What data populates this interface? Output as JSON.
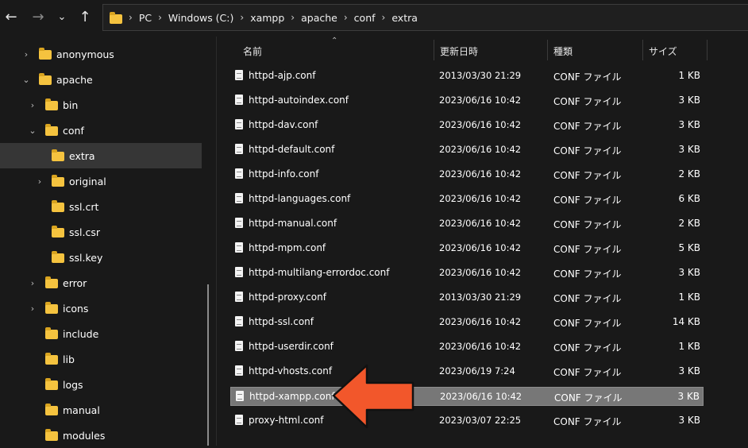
{
  "nav": {
    "back_icon": "arrow-left-icon",
    "forward_icon": "arrow-right-icon",
    "recent_icon": "chevron-down-icon",
    "up_icon": "arrow-up-icon"
  },
  "breadcrumb": [
    "PC",
    "Windows (C:)",
    "xampp",
    "apache",
    "conf",
    "extra"
  ],
  "tree": [
    {
      "label": "anonymous",
      "chevron": "›",
      "level": 1
    },
    {
      "label": "apache",
      "chevron": "⌄",
      "level": 1
    },
    {
      "label": "bin",
      "chevron": "›",
      "level": 2
    },
    {
      "label": "conf",
      "chevron": "⌄",
      "level": 2
    },
    {
      "label": "extra",
      "chevron": "",
      "level": 3,
      "selected": true
    },
    {
      "label": "original",
      "chevron": "›",
      "level": 3
    },
    {
      "label": "ssl.crt",
      "chevron": "",
      "level": 3
    },
    {
      "label": "ssl.csr",
      "chevron": "",
      "level": 3
    },
    {
      "label": "ssl.key",
      "chevron": "",
      "level": 3
    },
    {
      "label": "error",
      "chevron": "›",
      "level": 2
    },
    {
      "label": "icons",
      "chevron": "›",
      "level": 2
    },
    {
      "label": "include",
      "chevron": "",
      "level": 2
    },
    {
      "label": "lib",
      "chevron": "",
      "level": 2
    },
    {
      "label": "logs",
      "chevron": "",
      "level": 2
    },
    {
      "label": "manual",
      "chevron": "",
      "level": 2
    },
    {
      "label": "modules",
      "chevron": "",
      "level": 2
    }
  ],
  "columns": {
    "name": "名前",
    "date": "更新日時",
    "type": "種類",
    "size": "サイズ"
  },
  "files": [
    {
      "name": "httpd-ajp.conf",
      "date": "2013/03/30 21:29",
      "type": "CONF ファイル",
      "size": "1 KB"
    },
    {
      "name": "httpd-autoindex.conf",
      "date": "2023/06/16 10:42",
      "type": "CONF ファイル",
      "size": "3 KB"
    },
    {
      "name": "httpd-dav.conf",
      "date": "2023/06/16 10:42",
      "type": "CONF ファイル",
      "size": "3 KB"
    },
    {
      "name": "httpd-default.conf",
      "date": "2023/06/16 10:42",
      "type": "CONF ファイル",
      "size": "3 KB"
    },
    {
      "name": "httpd-info.conf",
      "date": "2023/06/16 10:42",
      "type": "CONF ファイル",
      "size": "2 KB"
    },
    {
      "name": "httpd-languages.conf",
      "date": "2023/06/16 10:42",
      "type": "CONF ファイル",
      "size": "6 KB"
    },
    {
      "name": "httpd-manual.conf",
      "date": "2023/06/16 10:42",
      "type": "CONF ファイル",
      "size": "2 KB"
    },
    {
      "name": "httpd-mpm.conf",
      "date": "2023/06/16 10:42",
      "type": "CONF ファイル",
      "size": "5 KB"
    },
    {
      "name": "httpd-multilang-errordoc.conf",
      "date": "2023/06/16 10:42",
      "type": "CONF ファイル",
      "size": "3 KB"
    },
    {
      "name": "httpd-proxy.conf",
      "date": "2013/03/30 21:29",
      "type": "CONF ファイル",
      "size": "1 KB"
    },
    {
      "name": "httpd-ssl.conf",
      "date": "2023/06/16 10:42",
      "type": "CONF ファイル",
      "size": "14 KB"
    },
    {
      "name": "httpd-userdir.conf",
      "date": "2023/06/16 10:42",
      "type": "CONF ファイル",
      "size": "1 KB"
    },
    {
      "name": "httpd-vhosts.conf",
      "date": "2023/06/19 7:24",
      "type": "CONF ファイル",
      "size": "3 KB"
    },
    {
      "name": "httpd-xampp.conf",
      "date": "2023/06/16 10:42",
      "type": "CONF ファイル",
      "size": "3 KB",
      "selected": true
    },
    {
      "name": "proxy-html.conf",
      "date": "2023/03/07 22:25",
      "type": "CONF ファイル",
      "size": "3 KB"
    }
  ],
  "colors": {
    "background": "#191919",
    "folder": "#f5c33f",
    "selected_row": "#777777",
    "annotation_arrow": "#f2572b"
  },
  "annotation": {
    "icon": "pointer-arrow-icon"
  }
}
